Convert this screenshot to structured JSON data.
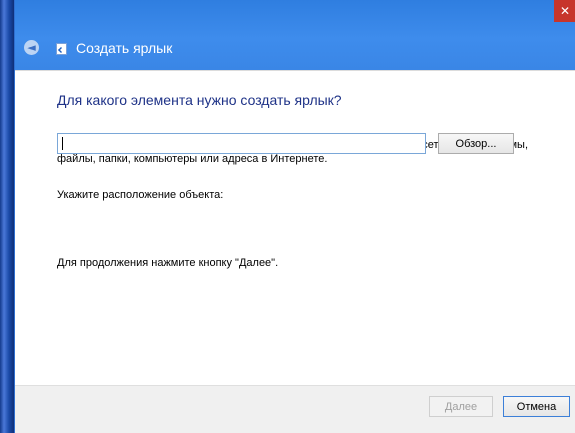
{
  "window": {
    "title": "Создать ярлык",
    "close_glyph": "✕",
    "back_glyph": "◄"
  },
  "content": {
    "heading": "Для какого элемента нужно создать ярлык?",
    "description": "Этот мастер помогает создать ярлык, указывающий на локальные или сетевые программы, файлы, папки, компьютеры или адреса в Интернете.",
    "location_label": "Укажите расположение объекта:",
    "location_value": "",
    "location_placeholder": "",
    "browse_label": "Обзор...",
    "hint": "Для продолжения нажмите кнопку \"Далее\"."
  },
  "footer": {
    "next_label": "Далее",
    "cancel_label": "Отмена"
  },
  "colors": {
    "titlebar": "#3a86e6",
    "heading": "#1e3287",
    "close": "#c7352b"
  }
}
